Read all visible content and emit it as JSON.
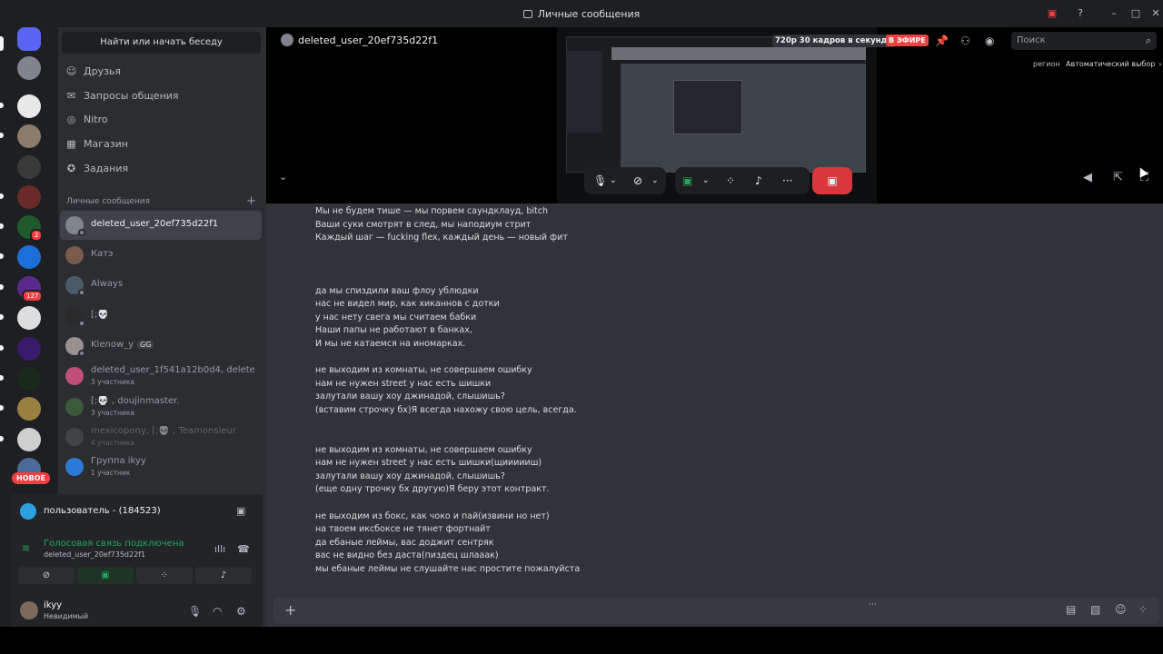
{
  "window": {
    "title": "Личные сообщения"
  },
  "sidebar": {
    "search_button": "Найти или начать беседу",
    "nav": [
      {
        "label": "Друзья",
        "icon": "friends-icon"
      },
      {
        "label": "Запросы общения",
        "icon": "mail-icon"
      },
      {
        "label": "Nitro",
        "icon": "nitro-icon"
      },
      {
        "label": "Магазин",
        "icon": "shop-icon"
      },
      {
        "label": "Задания",
        "icon": "quests-icon"
      }
    ],
    "section_header": "Личные сообщения",
    "dms": [
      {
        "name": "deleted_user_20ef735d22f1",
        "active": true
      },
      {
        "name": "Катэ"
      },
      {
        "name": "Always"
      },
      {
        "name": "[;💀"
      },
      {
        "name": "Klenow_y",
        "tag": "GG"
      },
      {
        "name": "deleted_user_1f541a12b0d4, deleted...",
        "sub": "3 участника"
      },
      {
        "name": "[;💀 , doujinmaster.",
        "sub": "3 участника"
      },
      {
        "name": "mexicopony, [;💀 , Teamonsieur",
        "sub": "4 участника"
      },
      {
        "name": "Группа ikyy",
        "sub": "1 участник"
      }
    ]
  },
  "rail": {
    "badges": [
      "2",
      "127"
    ],
    "new_badge": "НОВОЕ"
  },
  "voice_panel": {
    "stream_user": "пользователь - (184523)",
    "status": "Голосовая связь подключена",
    "channel": "deleted_user_20ef735d22f1"
  },
  "account": {
    "name": "ikyy",
    "status": "Невидимый"
  },
  "header": {
    "name": "deleted_user_20ef735d22f1",
    "stream_quality": "720p 30 кадров в секунду",
    "live": "В ЭФИРЕ",
    "search_placeholder": "Поиск",
    "region_label": "регион",
    "region_value": "Автоматический выбор"
  },
  "chat": {
    "lines": [
      "Мы не будем тише — мы порвем саундклауд, bitch",
      "Ваши суки смотрят в след, мы наподиум стрит",
      "Каждый шаг — fucking flex, каждый день — новый фит",
      "",
      "",
      "",
      "да мы спиздили ваш флоу ублюдки",
      "нас не видел мир, как хиканнов с дотки",
      "у нас нету свега мы считаем бабки",
      "Наши папы не работают в банках,",
      "И мы не катаемся на иномарках.",
      "",
      "не выходим из комнаты, не совершаем ошибку",
      "нам не нужен street у нас есть шишки",
      "залутали вашу хоу джинадой, слышишь?",
      "(вставим строчку бх)Я всегда нахожу свою цель, всегда.",
      "",
      "",
      "не выходим из комнаты, не совершаем ошибку",
      "нам не нужен street у нас есть шишки(щиииииш)",
      "залутали вашу хоу джинадой, слышишь?",
      "(еще одну трочку бх другую)Я беру этот контракт.",
      "",
      "не выходим из бокс, как чоко и пай(извини но нет)",
      "на твоем иксбоксе не тянет фортнайт",
      "да ебаные леймы, вас доджит сентряк",
      "вас не видно без даста(пиздец шлаaак)",
      "мы ебаные леймы не слушайте нас простите пожалуйста"
    ]
  },
  "composer": {
    "typing": "···"
  },
  "colors": {
    "accent": "#5865f2",
    "online": "#23a55a",
    "danger": "#f23f42"
  }
}
